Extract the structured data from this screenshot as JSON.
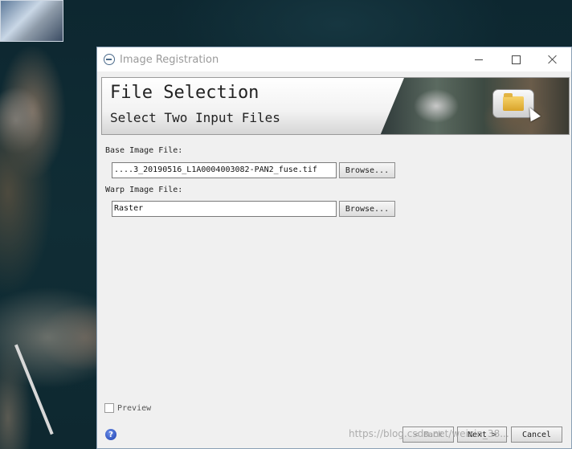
{
  "window": {
    "title": "Image Registration"
  },
  "banner": {
    "title": "File Selection",
    "subtitle": "Select Two Input Files"
  },
  "base": {
    "label": "Base Image File:",
    "value": "....3_20190516_L1A0004003082-PAN2_fuse.tif",
    "browse": "Browse..."
  },
  "warp": {
    "label": "Warp Image File:",
    "value": "Raster",
    "browse": "Browse..."
  },
  "preview": {
    "label": "Preview",
    "checked": false
  },
  "footer": {
    "back": "< Back",
    "next": "Next >",
    "cancel": "Cancel"
  },
  "watermark": "https://blog.csdn.net/weixin_38..."
}
